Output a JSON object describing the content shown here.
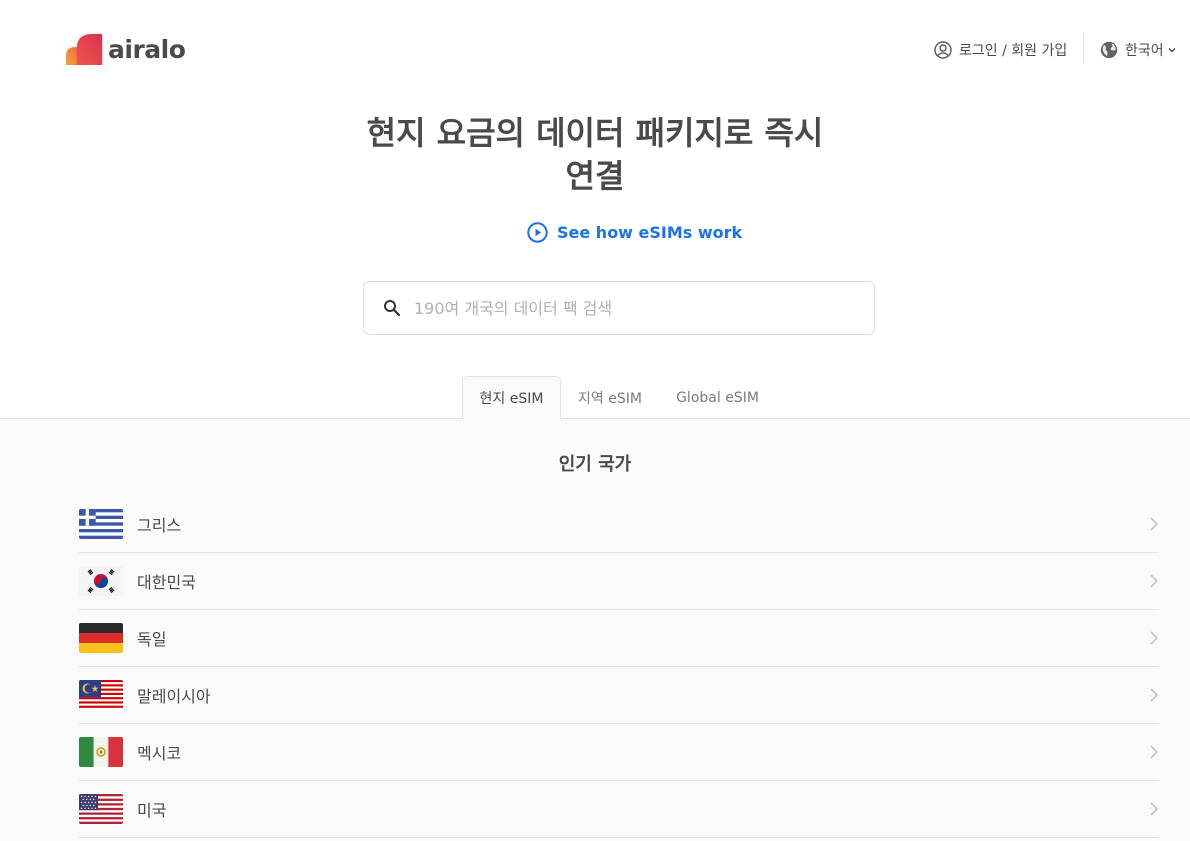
{
  "header": {
    "logo_text": "airalo",
    "login_label": "로그인 / 회원 가입",
    "language_label": "한국어"
  },
  "hero": {
    "title_line1": "현지 요금의 데이터 패키지로 즉시",
    "title_line2": "연결",
    "how_link": "See how eSIMs work"
  },
  "search": {
    "placeholder": "190여 개국의 데이터 팩 검색"
  },
  "tabs": [
    {
      "label": "현지 eSIM",
      "active": true
    },
    {
      "label": "지역 eSIM",
      "active": false
    },
    {
      "label": "Global eSIM",
      "active": false
    }
  ],
  "popular": {
    "title": "인기 국가",
    "countries": [
      {
        "name": "그리스",
        "flag": "greece-flag"
      },
      {
        "name": "대한민국",
        "flag": "south-korea-flag"
      },
      {
        "name": "독일",
        "flag": "germany-flag"
      },
      {
        "name": "말레이시아",
        "flag": "malaysia-flag"
      },
      {
        "name": "멕시코",
        "flag": "mexico-flag"
      },
      {
        "name": "미국",
        "flag": "usa-flag"
      }
    ]
  },
  "colors": {
    "accent": "#1a73e8",
    "text": "#4a4a4a",
    "background_section": "#fafafa"
  }
}
